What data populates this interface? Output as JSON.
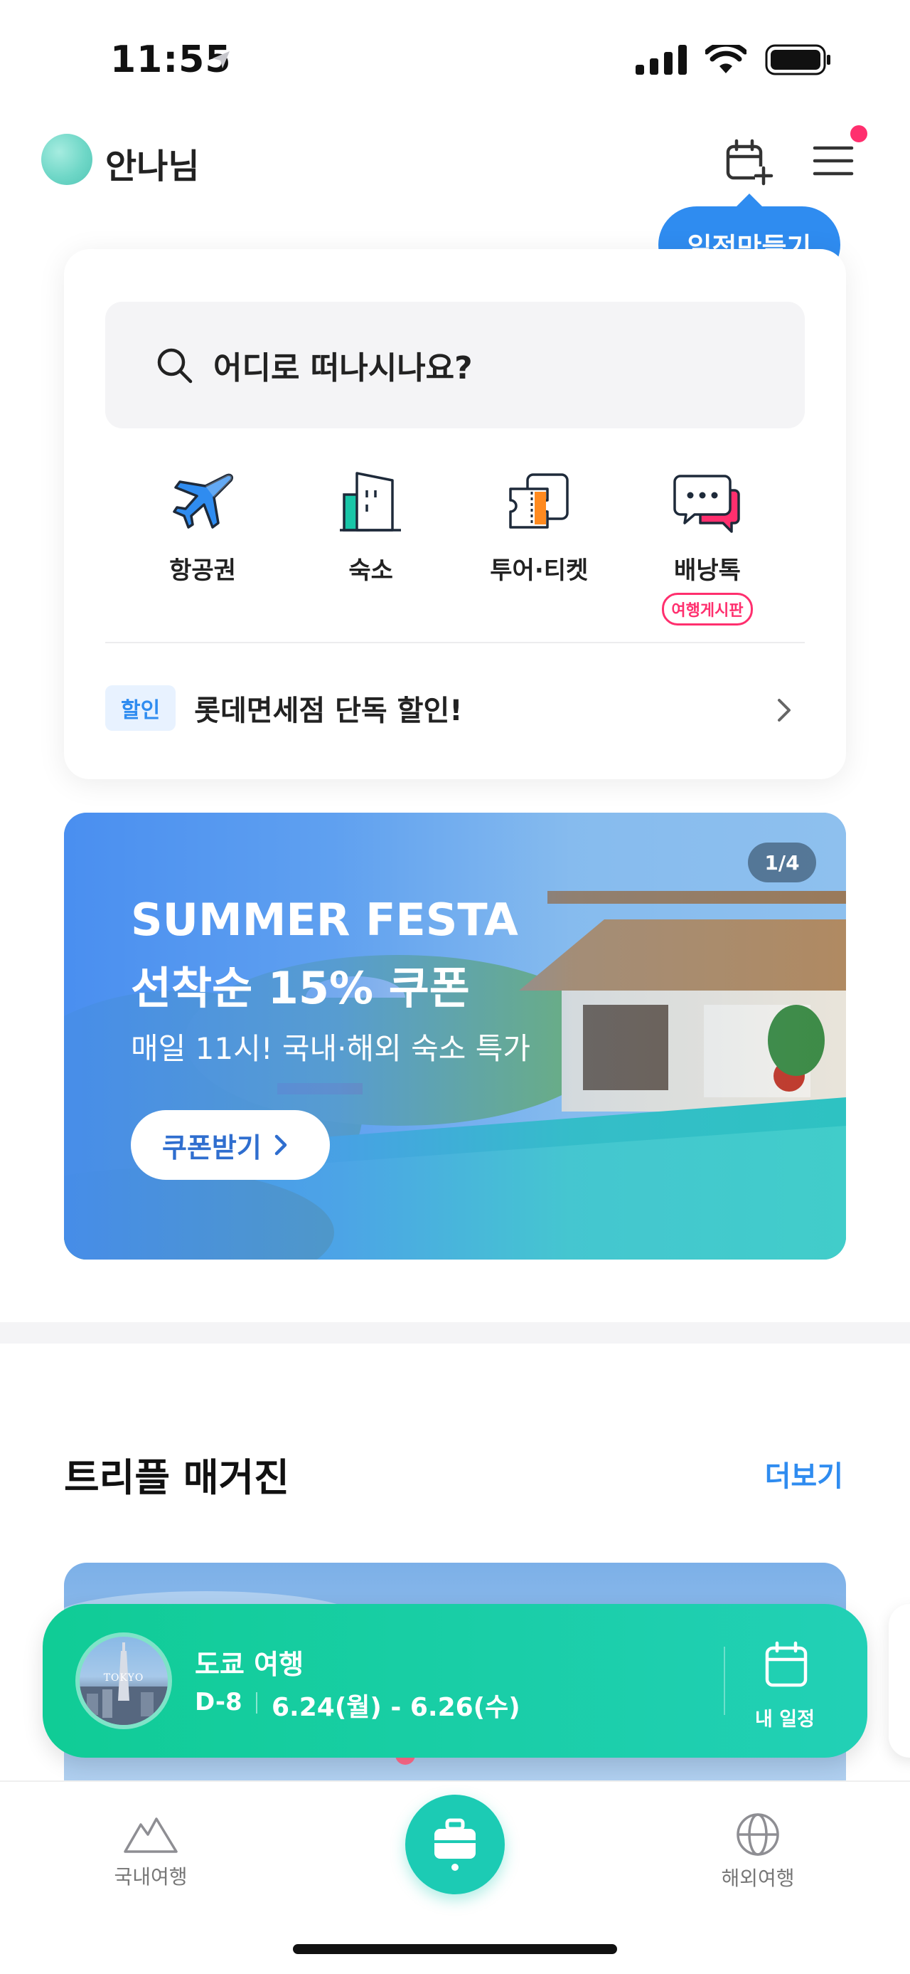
{
  "status_bar": {
    "time": "11:55"
  },
  "header": {
    "user_name": "안나님"
  },
  "tooltip": {
    "label": "일정만들기"
  },
  "search": {
    "placeholder": "어디로 떠나시나요?"
  },
  "categories": [
    {
      "label": "항공권",
      "icon": "airplane-icon"
    },
    {
      "label": "숙소",
      "icon": "building-icon"
    },
    {
      "label": "투어·티켓",
      "icon": "ticket-icon"
    },
    {
      "label": "배낭톡",
      "icon": "chat-icon",
      "badge": "여행게시판"
    }
  ],
  "promo": {
    "badge": "할인",
    "text": "롯데면세점 단독 할인!"
  },
  "banner": {
    "counter": "1/4",
    "title1": "SUMMER FESTA",
    "title2": "선착순 15% 쿠폰",
    "subtitle": "매일 11시! 국내·해외 숙소 특가",
    "button": "쿠폰받기"
  },
  "magazine": {
    "title": "트리플 매거진",
    "more": "더보기"
  },
  "trip": {
    "name": "도쿄 여행",
    "dday": "D-8",
    "dates": "6.24(월) - 6.26(수)",
    "thumb_text": "TOKYO",
    "action_label": "내 일정"
  },
  "tabs": {
    "domestic": "국내여행",
    "overseas": "해외여행"
  },
  "colors": {
    "accent_blue": "#2f8cf0",
    "accent_green": "#1ccbb4",
    "notification": "#ff2f6e"
  }
}
